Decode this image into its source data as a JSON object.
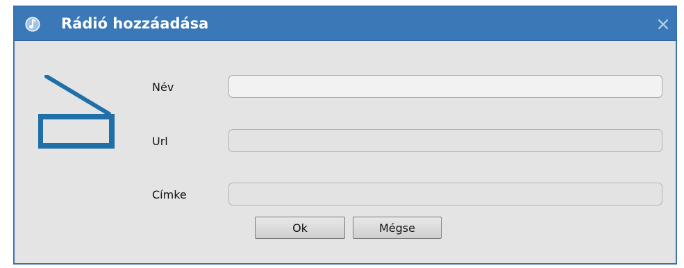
{
  "dialog": {
    "title": "Rádió hozzáadása",
    "app_icon": "music-note-icon",
    "close_icon": "close-icon",
    "illustration_icon": "radio-icon"
  },
  "form": {
    "name_label": "Név",
    "name_value": "",
    "url_label": "Url",
    "url_value": "",
    "tag_label": "Címke",
    "tag_value": ""
  },
  "buttons": {
    "ok_label": "Ok",
    "cancel_label": "Mégse"
  },
  "colors": {
    "titlebar": "#3b78b8",
    "icon_blue": "#1f6fa8",
    "dialog_background": "#e4e4e4"
  }
}
